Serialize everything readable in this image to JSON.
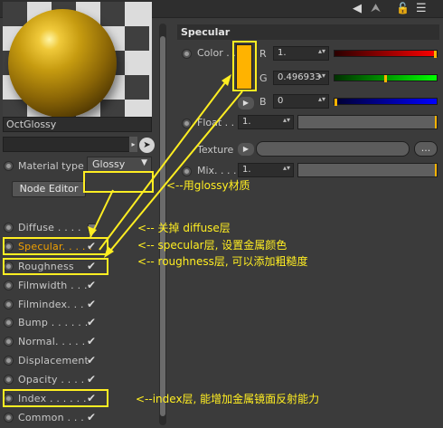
{
  "topbar": {
    "icon_arrow": "◀",
    "icon_cursor": "⮝",
    "icon_lock": "🔓",
    "icon_list": "☰"
  },
  "left": {
    "material_name": "OctGlossy",
    "material_type_label": "Material type",
    "material_type_value": "Glossy",
    "node_editor_label": "Node Editor",
    "channels": [
      {
        "label": "Diffuse",
        "dots": ". . . .",
        "checked": false
      },
      {
        "label": "Specular",
        "dots": ". . . . .",
        "checked": true
      },
      {
        "label": "Roughness",
        "dots": "",
        "checked": true
      },
      {
        "label": "Filmwidth",
        "dots": " . . .",
        "checked": true
      },
      {
        "label": "Filmindex",
        "dots": ". . .",
        "checked": true
      },
      {
        "label": "Bump",
        "dots": " . . . . . .",
        "checked": true
      },
      {
        "label": "Normal",
        "dots": ". . . . .",
        "checked": true
      },
      {
        "label": "Displacement",
        "dots": "",
        "checked": true
      },
      {
        "label": "Opacity",
        "dots": " . . . .",
        "checked": true
      },
      {
        "label": "Index",
        "dots": " . . . . . .",
        "checked": true
      },
      {
        "label": "Common",
        "dots": " . . .",
        "checked": true
      }
    ],
    "check_glyph": "✔"
  },
  "right": {
    "section_title": "Specular",
    "color_label": "Color . .",
    "r_label": "R",
    "r_value": "1.",
    "g_label": "G",
    "g_value": "0.496933",
    "b_label": "B",
    "b_value": "0",
    "float_label": "Float . .",
    "float_value": "1.",
    "texture_label": "Texture",
    "mix_label": "Mix. . . .",
    "mix_value": "1.",
    "dots_button": "...",
    "play_glyph": "▶",
    "swatch_color": "#ffb300"
  },
  "annotations": {
    "glossy": "<--用glossy材质",
    "diffuse": "<-- 关掉 diffuse层",
    "specular": "<-- specular层, 设置金属颜色",
    "roughness": "<-- roughness层, 可以添加粗糙度",
    "index": "<--index层, 能增加金属镜面反射能力",
    "color": "#ffee22"
  }
}
